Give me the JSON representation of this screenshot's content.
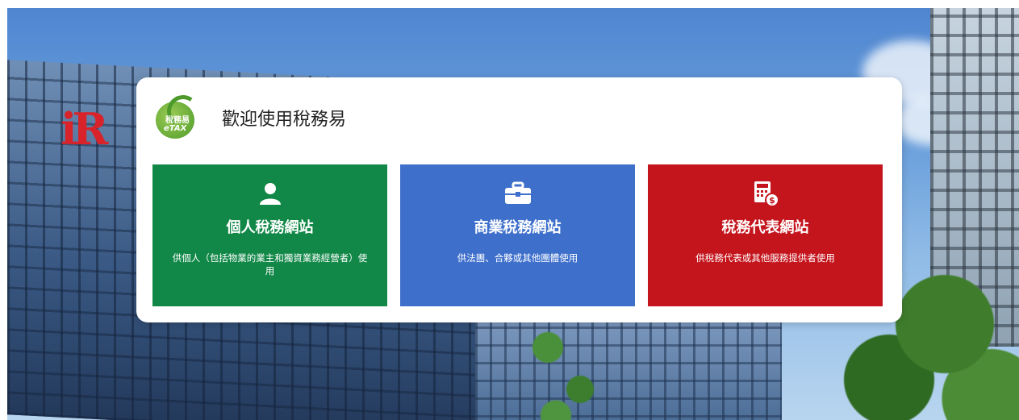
{
  "header": {
    "logo_text_1": "稅務易",
    "logo_text_2": "eTAX",
    "title": "歡迎使用稅務易"
  },
  "background": {
    "logo_text": "iR"
  },
  "tiles": [
    {
      "title": "個人稅務網站",
      "description": "供個人（包括物業的業主和獨資業務經營者）使用",
      "icon": "person-icon",
      "color": "#118847"
    },
    {
      "title": "商業稅務網站",
      "description": "供法團、合夥或其他團體使用",
      "icon": "briefcase-icon",
      "color": "#3e6fcb"
    },
    {
      "title": "稅務代表網站",
      "description": "供稅務代表或其他服務提供者使用",
      "icon": "calculator-dollar-icon",
      "color": "#c4141c"
    }
  ]
}
